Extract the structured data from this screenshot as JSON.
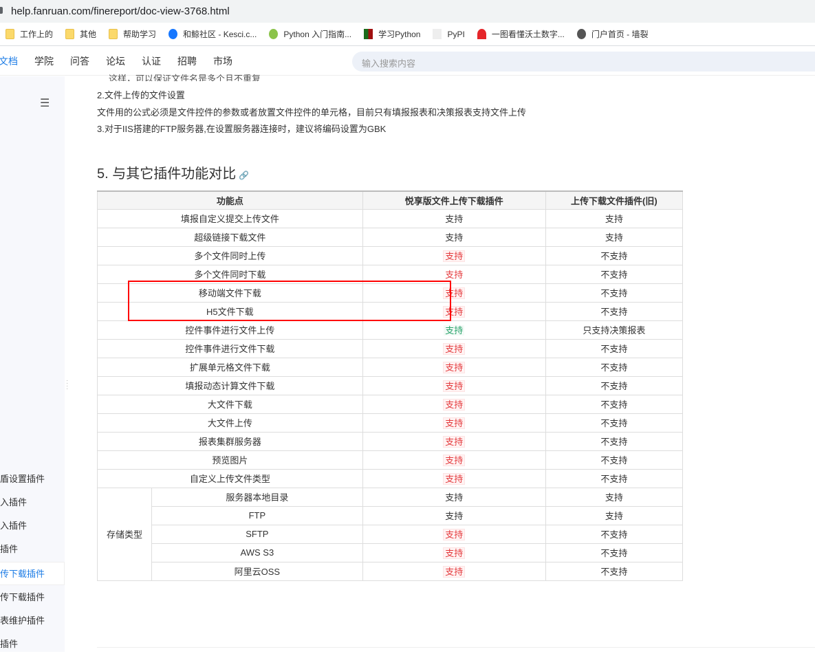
{
  "browser": {
    "url": "help.fanruan.com/finereport/doc-view-3768.html",
    "bookmarks": [
      {
        "label": "工作上的",
        "icon": "folder-icon"
      },
      {
        "label": "其他",
        "icon": "folder-icon"
      },
      {
        "label": "帮助学习",
        "icon": "folder-icon"
      },
      {
        "label": "和鲸社区 - Kesci.c...",
        "icon": "kesci-icon"
      },
      {
        "label": "Python 入门指南...",
        "icon": "python-icon"
      },
      {
        "label": "学习Python",
        "icon": "fc-icon"
      },
      {
        "label": "PyPI",
        "icon": "pypi-icon"
      },
      {
        "label": "一图看懂沃土数字...",
        "icon": "huawei-icon"
      },
      {
        "label": "门户首页 - 墙裂",
        "icon": "globe-icon"
      }
    ]
  },
  "nav": {
    "items": [
      "文档",
      "学院",
      "问答",
      "论坛",
      "认证",
      "招聘",
      "市场"
    ],
    "search_placeholder": "输入搜索内容"
  },
  "sidebar": {
    "items": [
      "盾设置插件",
      "入插件",
      "入插件",
      "插件",
      "传下载插件",
      "传下载插件",
      "表维护插件",
      "插件"
    ],
    "active_index": 4
  },
  "content": {
    "lines": [
      "这样，可以保证文件名是多个且不重复",
      "2.文件上传的文件设置",
      "文件用的公式必须是文件控件的参数或者放置文件控件的单元格，目前只有填报报表和决策报表支持文件上传",
      "3.对于IIS搭建的FTP服务器,在设置服务器连接时，建议将编码设置为GBK"
    ],
    "heading": "5. 与其它插件功能对比",
    "table": {
      "headers": [
        "功能点",
        "悦享版文件上传下载插件",
        "上传下载文件插件(旧)"
      ],
      "rows": [
        {
          "feature": "填报自定义提交上传文件",
          "new": "支持",
          "new_style": "plain",
          "old": "支持"
        },
        {
          "feature": "超级链接下载文件",
          "new": "支持",
          "new_style": "plain",
          "old": "支持"
        },
        {
          "feature": "多个文件同时上传",
          "new": "支持",
          "new_style": "red",
          "old": "不支持"
        },
        {
          "feature": "多个文件同时下载",
          "new": "支持",
          "new_style": "red2",
          "old": "不支持"
        },
        {
          "feature": "移动端文件下载",
          "new": "支持",
          "new_style": "red",
          "old": "不支持"
        },
        {
          "feature": "H5文件下载",
          "new": "支持",
          "new_style": "red",
          "old": "不支持"
        },
        {
          "feature": "控件事件进行文件上传",
          "new": "支持",
          "new_style": "green",
          "old": "只支持决策报表"
        },
        {
          "feature": "控件事件进行文件下载",
          "new": "支持",
          "new_style": "red",
          "old": "不支持"
        },
        {
          "feature": "扩展单元格文件下载",
          "new": "支持",
          "new_style": "red",
          "old": "不支持"
        },
        {
          "feature": "填报动态计算文件下载",
          "new": "支持",
          "new_style": "red",
          "old": "不支持"
        },
        {
          "feature": "大文件下载",
          "new": "支持",
          "new_style": "red",
          "old": "不支持"
        },
        {
          "feature": "大文件上传",
          "new": "支持",
          "new_style": "red",
          "old": "不支持"
        },
        {
          "feature": "报表集群服务器",
          "new": "支持",
          "new_style": "red",
          "old": "不支持"
        },
        {
          "feature": "预览图片",
          "new": "支持",
          "new_style": "red",
          "old": "不支持"
        },
        {
          "feature": "自定义上传文件类型",
          "new": "支持",
          "new_style": "red",
          "old": "不支持"
        }
      ],
      "storage_group": "存储类型",
      "storage_rows": [
        {
          "feature": "服务器本地目录",
          "new": "支持",
          "new_style": "plain",
          "old": "支持"
        },
        {
          "feature": "FTP",
          "new": "支持",
          "new_style": "plain",
          "old": "支持"
        },
        {
          "feature": "SFTP",
          "new": "支持",
          "new_style": "red",
          "old": "不支持"
        },
        {
          "feature": "AWS S3",
          "new": "支持",
          "new_style": "red",
          "old": "不支持"
        },
        {
          "feature": "阿里云OSS",
          "new": "支持",
          "new_style": "red",
          "old": "不支持"
        }
      ]
    }
  }
}
